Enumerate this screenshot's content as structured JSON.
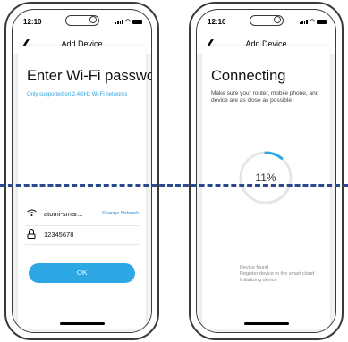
{
  "left_screen": {
    "status_time": "12:10",
    "nav_title": "Add Device",
    "back_icon": "chevron-left-icon",
    "heading": "Enter Wi-Fi password",
    "subheading": "Only supported on 2.4GHz Wi-Fi networks",
    "wifi_name": "atomi-smar...",
    "change_network": "Change Network",
    "password": "12345678",
    "ok_label": "OK",
    "accent_color": "#2ea8e5"
  },
  "right_screen": {
    "status_time": "12:10",
    "nav_title": "Add Device",
    "back_icon": "chevron-left-icon",
    "heading": "Connecting",
    "description": "Make sure your router, mobile phone, and device are as close as possible",
    "progress_text": "11%",
    "progress": 0.11,
    "steps": [
      "Device found",
      "Register device to the smart cloud",
      "Initializing device"
    ]
  }
}
